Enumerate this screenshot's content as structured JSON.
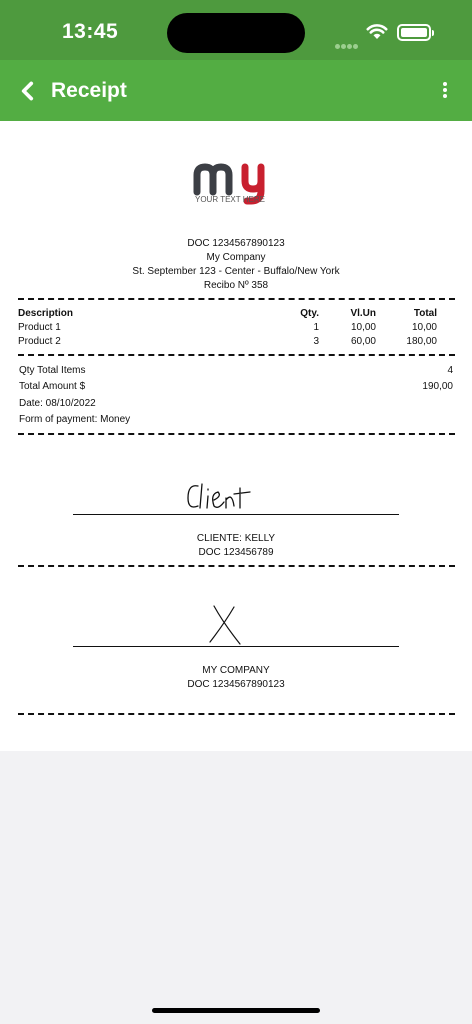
{
  "status_bar": {
    "time": "13:45"
  },
  "nav": {
    "title": "Receipt"
  },
  "logo": {
    "caption": "YOUR TEXT HERE"
  },
  "header": {
    "doc": "DOC 1234567890123",
    "company": "My Company",
    "address": "St. September 123 - Center - Buffalo/New York",
    "receipt_no": "Recibo Nº 358"
  },
  "items": {
    "columns": {
      "description": "Description",
      "qty": "Qty.",
      "unit": "Vl.Un",
      "total": "Total"
    },
    "rows": [
      {
        "description": "Product 1",
        "qty": "1",
        "unit": "10,00",
        "total": "10,00"
      },
      {
        "description": "Product 2",
        "qty": "3",
        "unit": "60,00",
        "total": "180,00"
      }
    ]
  },
  "summary": {
    "qty_label": "Qty Total Items",
    "qty_value": "4",
    "amount_label": "Total Amount $",
    "amount_value": "190,00",
    "date": "Date: 08/10/2022",
    "payment": "Form of payment: Money"
  },
  "client_signature": {
    "handwriting": "Client",
    "name": "CLIENTE: KELLY",
    "doc": "DOC 123456789"
  },
  "company_signature": {
    "name": "MY COMPANY",
    "doc": "DOC 1234567890123"
  },
  "colors": {
    "status_green": "#4e9a3e",
    "nav_green": "#53ad43",
    "logo_dark": "#3c3f45",
    "logo_red": "#c8202f"
  }
}
